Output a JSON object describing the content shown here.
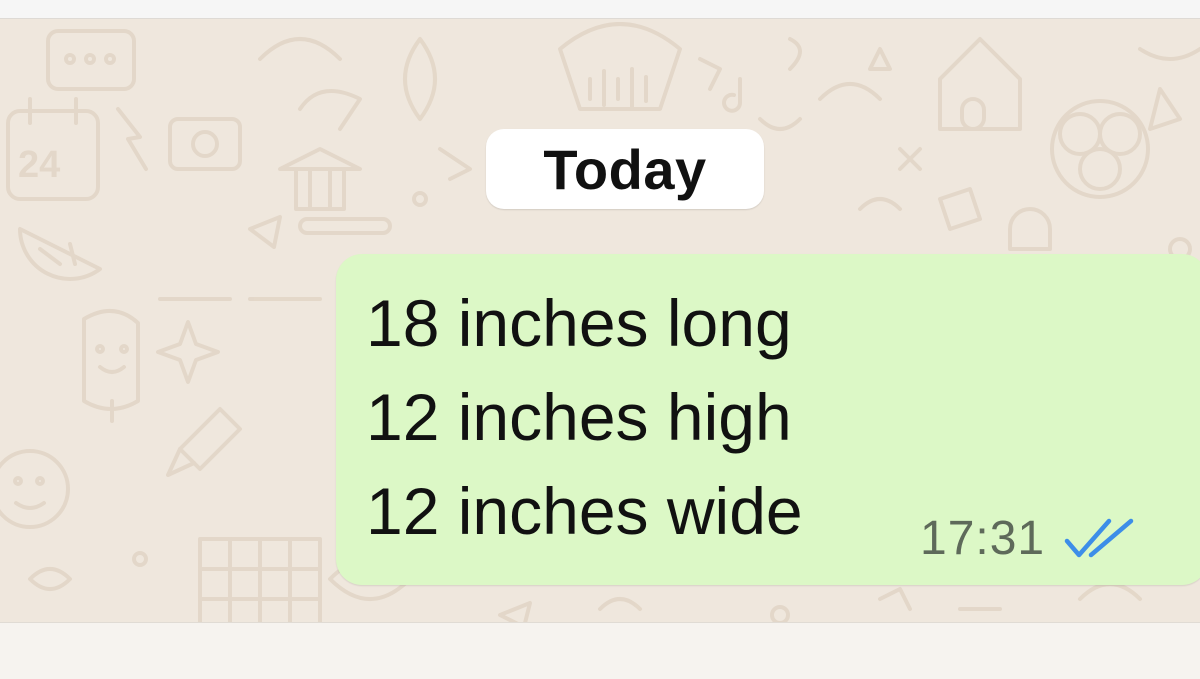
{
  "date_separator": {
    "label": "Today"
  },
  "message": {
    "lines": [
      "18 inches long",
      "12 inches high",
      "12 inches wide"
    ],
    "time": "17:31",
    "status_icon": "double-check-read-icon"
  },
  "colors": {
    "chat_background": "#efe7dd",
    "outgoing_bubble": "#dcf8c6",
    "date_chip": "#ffffff",
    "read_ticks": "#3d8ee8",
    "timestamp": "#5e6a5a"
  }
}
